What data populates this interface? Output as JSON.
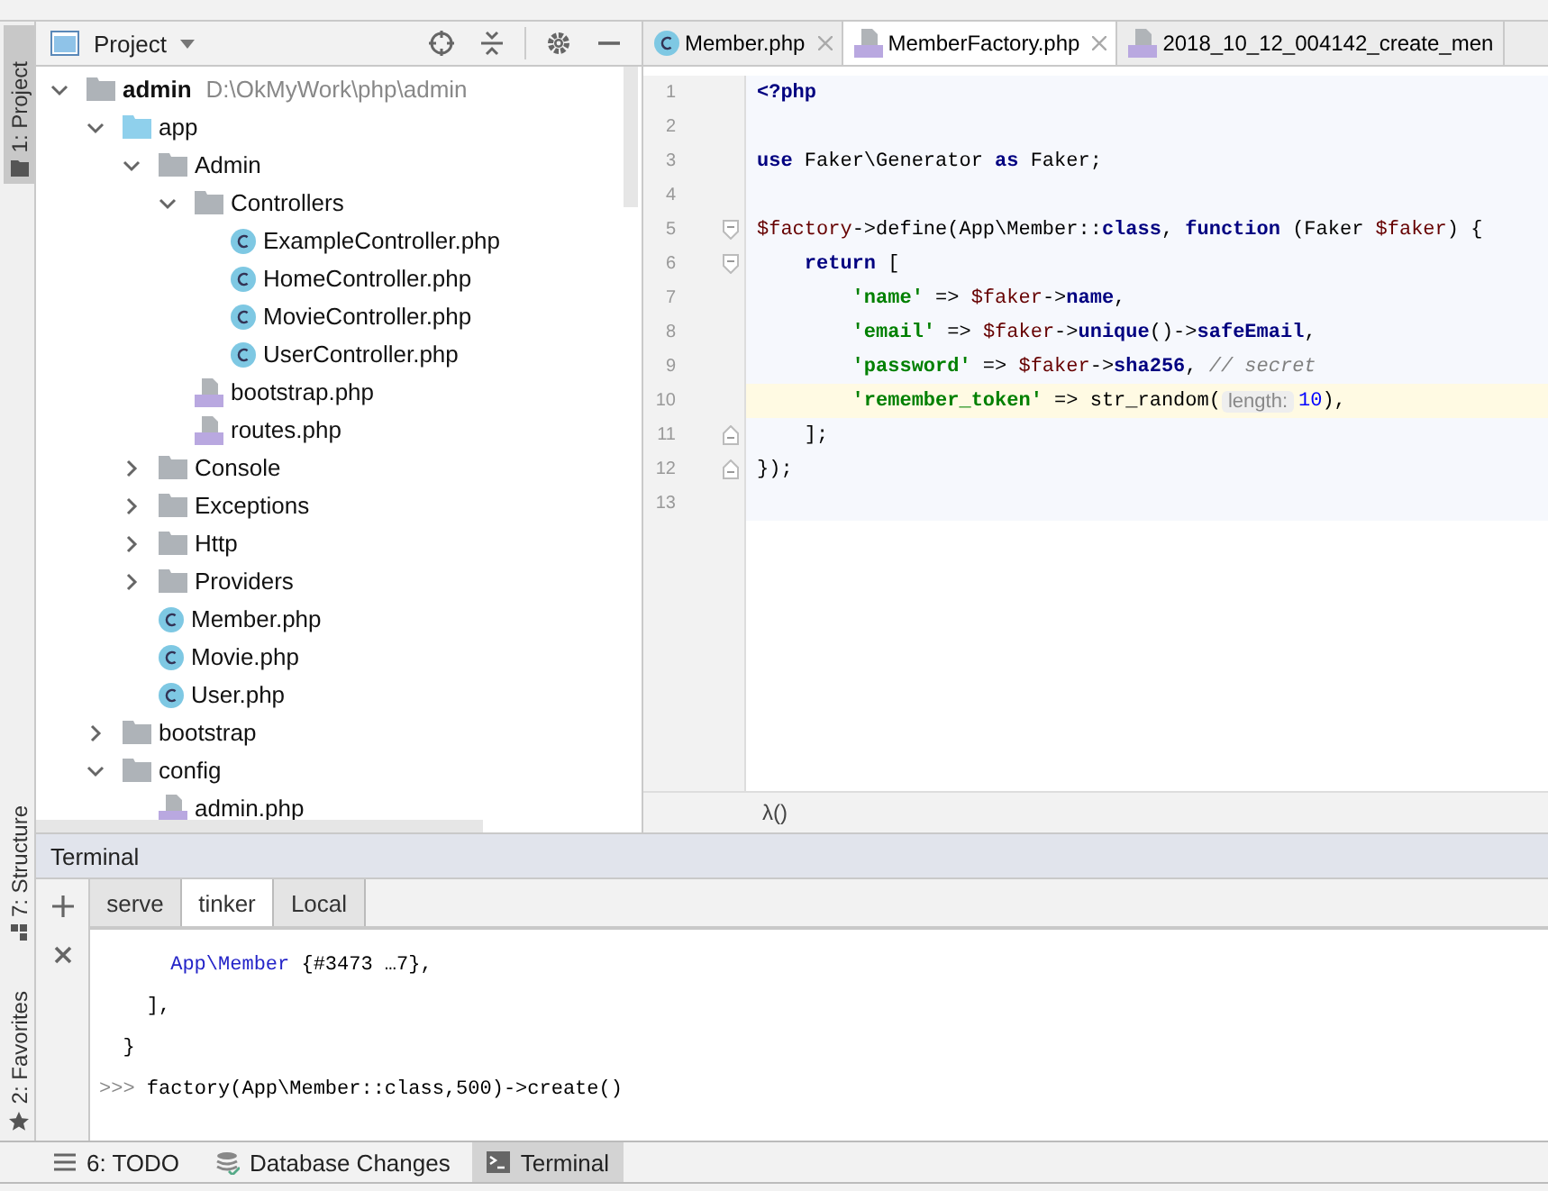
{
  "tool_strip": [
    {
      "label": "1: Project",
      "kind": "folder",
      "selected": true
    },
    {
      "label": "7: Structure",
      "kind": "structure",
      "selected": false
    },
    {
      "label": "2: Favorites",
      "kind": "star",
      "selected": false
    }
  ],
  "project": {
    "title": "Project",
    "tree": [
      {
        "name": "admin",
        "hint": "D:\\OkMyWork\\php\\admin",
        "kind": "folder",
        "expanded": true,
        "children": [
          {
            "name": "app",
            "kind": "source-folder",
            "expanded": true,
            "children": [
              {
                "name": "Admin",
                "kind": "folder",
                "expanded": true,
                "children": [
                  {
                    "name": "Controllers",
                    "kind": "folder",
                    "expanded": true,
                    "children": [
                      {
                        "name": "ExampleController.php",
                        "kind": "class"
                      },
                      {
                        "name": "HomeController.php",
                        "kind": "class"
                      },
                      {
                        "name": "MovieController.php",
                        "kind": "class"
                      },
                      {
                        "name": "UserController.php",
                        "kind": "class"
                      }
                    ]
                  },
                  {
                    "name": "bootstrap.php",
                    "kind": "php"
                  },
                  {
                    "name": "routes.php",
                    "kind": "php"
                  }
                ]
              },
              {
                "name": "Console",
                "kind": "folder",
                "expanded": false
              },
              {
                "name": "Exceptions",
                "kind": "folder",
                "expanded": false
              },
              {
                "name": "Http",
                "kind": "folder",
                "expanded": false
              },
              {
                "name": "Providers",
                "kind": "folder",
                "expanded": false
              },
              {
                "name": "Member.php",
                "kind": "class"
              },
              {
                "name": "Movie.php",
                "kind": "class"
              },
              {
                "name": "User.php",
                "kind": "class"
              }
            ]
          },
          {
            "name": "bootstrap",
            "kind": "folder",
            "expanded": false
          },
          {
            "name": "config",
            "kind": "folder",
            "expanded": true,
            "children": [
              {
                "name": "admin.php",
                "kind": "php"
              }
            ]
          }
        ]
      }
    ]
  },
  "editor": {
    "tabs": [
      {
        "label": "Member.php",
        "kind": "class",
        "selected": false,
        "closable": true
      },
      {
        "label": "MemberFactory.php",
        "kind": "php",
        "selected": true,
        "closable": true
      },
      {
        "label": "2018_10_12_004142_create_men",
        "kind": "php",
        "selected": false,
        "closable": false
      }
    ],
    "lines": [
      {
        "number": "1",
        "kind": "plain",
        "current": false,
        "tokens": [
          {
            "kind": "keyword",
            "t": "<?php"
          }
        ]
      },
      {
        "number": "2",
        "kind": "plain",
        "current": false
      },
      {
        "number": "3",
        "kind": "plain",
        "current": false,
        "tokens": [
          {
            "kind": "keyword",
            "t": "use"
          },
          {
            "kind": "plain",
            "t": " Faker\\Generator "
          },
          {
            "kind": "keyword",
            "t": "as"
          },
          {
            "kind": "plain",
            "t": " Faker;"
          }
        ]
      },
      {
        "number": "4",
        "kind": "plain",
        "current": false
      },
      {
        "number": "5",
        "kind": "fold-start",
        "current": false,
        "tokens": [
          {
            "kind": "var",
            "t": "$factory"
          },
          {
            "kind": "plain",
            "t": "->define(App\\Member::"
          },
          {
            "kind": "keyword",
            "t": "class"
          },
          {
            "kind": "plain",
            "t": ", "
          },
          {
            "kind": "keyword",
            "t": "function"
          },
          {
            "kind": "plain",
            "t": " (Faker "
          },
          {
            "kind": "var",
            "t": "$faker"
          },
          {
            "kind": "plain",
            "t": ") {"
          }
        ]
      },
      {
        "number": "6",
        "kind": "fold-start",
        "current": false,
        "tokens": [
          {
            "kind": "keyword",
            "t": "    return"
          },
          {
            "kind": "plain",
            "t": " ["
          }
        ]
      },
      {
        "number": "7",
        "kind": "plain",
        "current": false,
        "tokens": [
          {
            "kind": "string",
            "t": "        'name'"
          },
          {
            "kind": "plain",
            "t": " => "
          },
          {
            "kind": "var",
            "t": "$faker"
          },
          {
            "kind": "plain",
            "t": "->"
          },
          {
            "kind": "member",
            "t": "name"
          },
          {
            "kind": "plain",
            "t": ","
          }
        ]
      },
      {
        "number": "8",
        "kind": "plain",
        "current": false,
        "tokens": [
          {
            "kind": "string",
            "t": "        'email'"
          },
          {
            "kind": "plain",
            "t": " => "
          },
          {
            "kind": "var",
            "t": "$faker"
          },
          {
            "kind": "plain",
            "t": "->"
          },
          {
            "kind": "member",
            "t": "unique"
          },
          {
            "kind": "plain",
            "t": "()->"
          },
          {
            "kind": "member",
            "t": "safeEmail"
          },
          {
            "kind": "plain",
            "t": ","
          }
        ]
      },
      {
        "number": "9",
        "kind": "plain",
        "current": false,
        "tokens": [
          {
            "kind": "string",
            "t": "        'password'"
          },
          {
            "kind": "plain",
            "t": " => "
          },
          {
            "kind": "var",
            "t": "$faker"
          },
          {
            "kind": "plain",
            "t": "->"
          },
          {
            "kind": "member",
            "t": "sha256"
          },
          {
            "kind": "plain",
            "t": ", "
          },
          {
            "kind": "comment",
            "t": "// secret"
          }
        ]
      },
      {
        "number": "10",
        "kind": "plain",
        "current": true,
        "tokens": [
          {
            "kind": "string",
            "t": "        'remember_token'"
          },
          {
            "kind": "plain",
            "t": " => str_random("
          },
          {
            "kind": "hint",
            "t": "length:"
          },
          {
            "kind": "number",
            "t": "10"
          },
          {
            "kind": "plain",
            "t": "),"
          }
        ]
      },
      {
        "number": "11",
        "kind": "fold-end",
        "current": false,
        "tokens": [
          {
            "kind": "plain",
            "t": "    ];"
          }
        ]
      },
      {
        "number": "12",
        "kind": "fold-end",
        "current": false,
        "tokens": [
          {
            "kind": "plain",
            "t": "});"
          }
        ]
      },
      {
        "number": "13",
        "kind": "plain",
        "current": false
      }
    ],
    "breadcrumb": "λ()"
  },
  "terminal": {
    "title": "Terminal",
    "tabs": [
      {
        "label": "serve",
        "selected": false
      },
      {
        "label": "tinker",
        "selected": true
      },
      {
        "label": "Local",
        "selected": false
      }
    ],
    "lines": [
      {
        "tokens": [
          {
            "kind": "class",
            "t": "      App\\Member"
          },
          {
            "kind": "plain",
            "t": " {#3473 …7},"
          }
        ]
      },
      {
        "tokens": [
          {
            "kind": "plain",
            "t": "    ],"
          }
        ]
      },
      {
        "tokens": [
          {
            "kind": "plain",
            "t": "  }"
          }
        ]
      },
      {
        "tokens": [
          {
            "kind": "prompt",
            "t": ">>>"
          },
          {
            "kind": "plain",
            "t": " factory(App\\Member::class,500)->create()"
          }
        ]
      }
    ]
  },
  "bottom_bar": [
    {
      "label": "6: TODO",
      "kind": "list",
      "selected": false
    },
    {
      "label": "Database Changes",
      "kind": "database",
      "selected": false
    },
    {
      "label": "Terminal",
      "kind": "terminal",
      "selected": true
    }
  ]
}
